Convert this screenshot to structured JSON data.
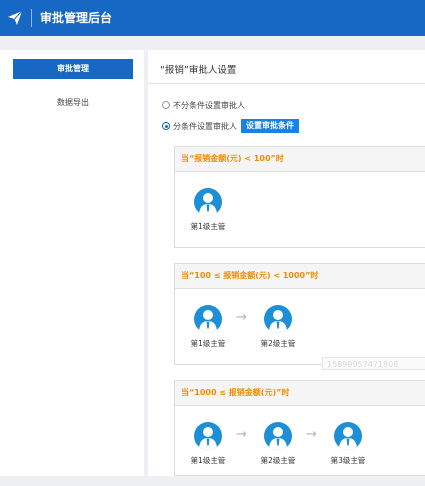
{
  "header": {
    "title": "审批管理后台",
    "logo_icon": "paper-plane-icon",
    "bg_color": "#1767c4"
  },
  "sidebar": {
    "items": [
      {
        "label": "审批管理",
        "active": true
      },
      {
        "label": "数据导出",
        "active": false
      }
    ]
  },
  "main": {
    "title": "“报销”审批人设置",
    "options": [
      {
        "label": "不分条件设置审批人",
        "checked": false
      },
      {
        "label": "分条件设置审批人",
        "checked": true
      }
    ],
    "set_conditions_button": "设置审批条件",
    "conditions": [
      {
        "header": "当“报销金额(元) < 100”时",
        "approvers": [
          "第1级主管"
        ]
      },
      {
        "header": "当“100 ≤ 报销金额(元) < 1000”时",
        "approvers": [
          "第1级主管",
          "第2级主管"
        ]
      },
      {
        "header": "当“1000 ≤ 报销金额(元)”时",
        "approvers": [
          "第1级主管",
          "第2级主管",
          "第3级主管"
        ]
      }
    ],
    "avatar_icon": "person-icon",
    "arrow_icon": "arrow-right-icon",
    "condition_color": "#f08c00",
    "avatar_color": "#1d8fd6"
  },
  "watermark": "15899957471808"
}
